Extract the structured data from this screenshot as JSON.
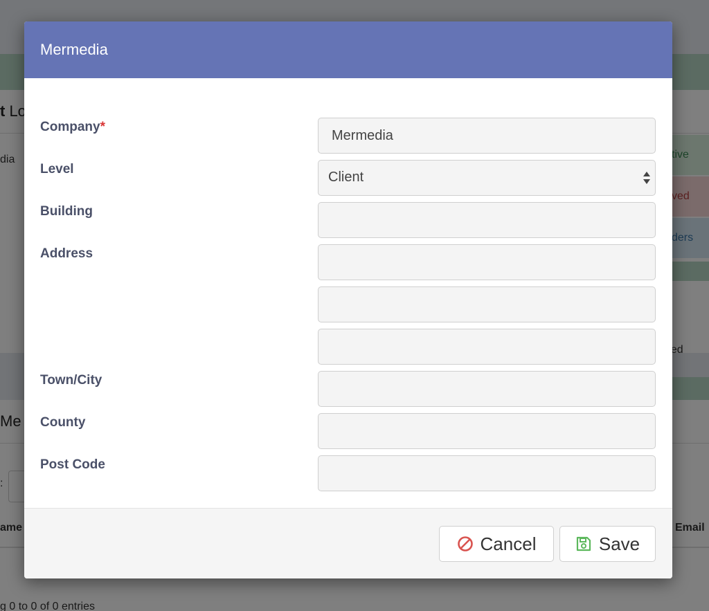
{
  "background": {
    "page_title_bold": "t",
    "page_title_rest": " Lo",
    "company_cell": "dia",
    "status_active": "tive",
    "status_removed": "ved",
    "status_orders": "ders",
    "assigned_text": "ned",
    "section_title": "Me",
    "search_colon": ":",
    "column_name": "ame",
    "column_email": "Email",
    "entries_info": "g 0 to 0 of 0 entries"
  },
  "modal": {
    "title": "Mermedia",
    "fields": {
      "company": {
        "label": "Company",
        "required_mark": "*",
        "value": "Mermedia"
      },
      "level": {
        "label": "Level",
        "value": "Client"
      },
      "building": {
        "label": "Building",
        "value": ""
      },
      "address": {
        "label": "Address",
        "line1": "",
        "line2": "",
        "line3": ""
      },
      "town": {
        "label": "Town/City",
        "value": ""
      },
      "county": {
        "label": "County",
        "value": ""
      },
      "postcode": {
        "label": "Post Code",
        "value": ""
      }
    },
    "buttons": {
      "cancel": "Cancel",
      "save": "Save"
    }
  },
  "colors": {
    "header": "#6574b5",
    "label": "#4a5068",
    "required": "#d93636",
    "cancel_icon": "#d9534f",
    "save_icon": "#5cb85c"
  },
  "icons": {
    "cancel": "ban-icon",
    "save": "floppy-disk-icon",
    "select": "select-arrows-icon"
  }
}
